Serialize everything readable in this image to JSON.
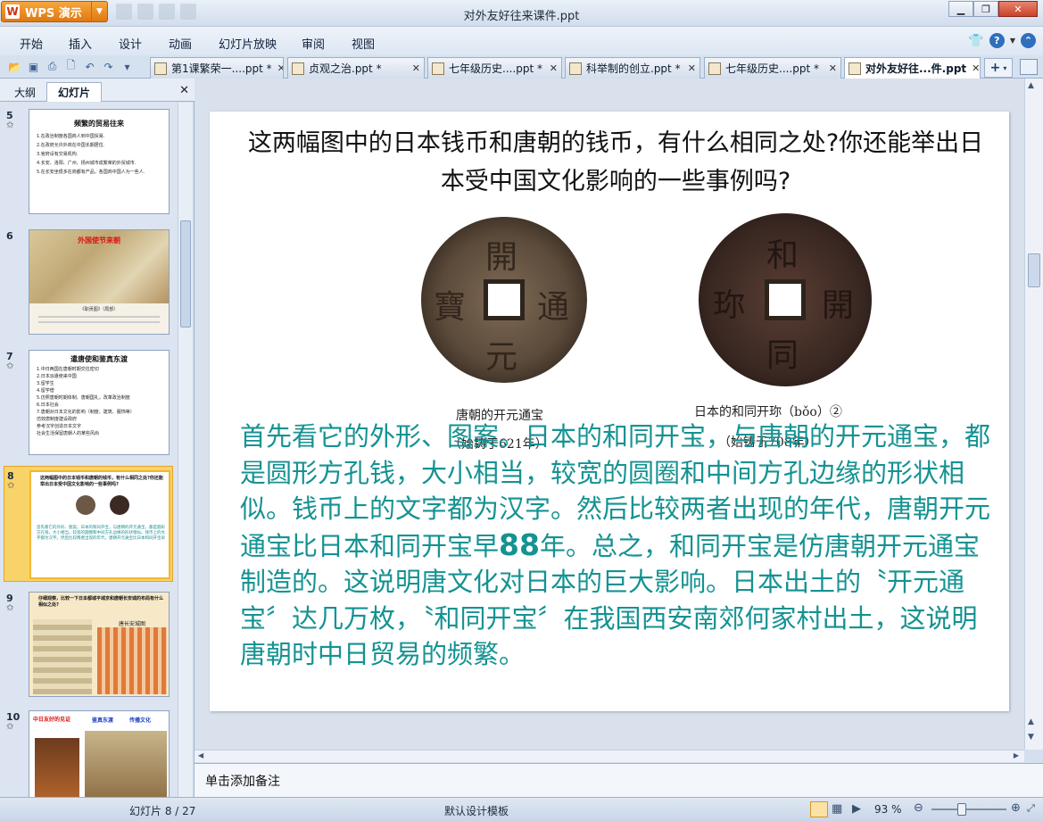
{
  "app": {
    "brand": "WPS 演示",
    "logo_letter": "W",
    "title": "对外友好往来课件.ppt"
  },
  "menu": [
    "开始",
    "插入",
    "设计",
    "动画",
    "幻灯片放映",
    "审阅",
    "视图"
  ],
  "tabs": [
    {
      "label": "第1课繁荣一....ppt *",
      "active": false
    },
    {
      "label": "贞观之治.ppt *",
      "active": false
    },
    {
      "label": "七年级历史....ppt *",
      "active": false
    },
    {
      "label": "科举制的创立.ppt *",
      "active": false
    },
    {
      "label": "七年级历史....ppt *",
      "active": false
    },
    {
      "label": "对外友好往...件.ppt",
      "active": true
    }
  ],
  "panel": {
    "tab_outline": "大纲",
    "tab_slides": "幻灯片"
  },
  "thumbnails": [
    {
      "num": "5",
      "title": "频繁的贸易往来",
      "lines": [
        "1.在政治制度各国商人到中国贸易.",
        "2.在政府允许外商在中国长期居住.",
        "3.官府设有交易机构.",
        "4.长安、洛阳、广州、扬州城市成繁荣的外贸城市.",
        "5.在长安坐很多在商都有产品，各国商中国人为一些人."
      ]
    },
    {
      "num": "6",
      "title": "外国使节来朝",
      "caption": "《职贡图》（局部）"
    },
    {
      "num": "7",
      "title": "遣唐使和鉴真东渡",
      "lines": [
        "1.中日两国在唐朝时期交往密切",
        "2.日本派遣使来中国",
        "3.留学生",
        "4.留学僧",
        "5.仿照唐朝时期体制、唐朝国礼，改革政治制度",
        "6.日本社会",
        "7.唐朝对日本文化的影响（制度、建筑、服饰等）",
        "仿效唐制度建设政府",
        "参考汉字创造日本文字",
        "社会生活保留唐朝人的某些风尚"
      ]
    },
    {
      "num": "8",
      "title": "这两幅图中的日本钱币和唐朝的钱币，有什么相同之处?你还能举出日本受中国文化影响的一些事例吗?"
    },
    {
      "num": "9",
      "title": "仔细观察，比较一下日本都城平城京和唐朝长安城的布局有什么相似之处?",
      "map_title": "唐长安城图"
    },
    {
      "num": "10",
      "title": "中日友好的见证",
      "sub1": "鉴真东渡",
      "sub2": "传播文化"
    }
  ],
  "slide": {
    "title": "这两幅图中的日本钱币和唐朝的钱币，有什么相同之处?你还能举出日本受中国文化影响的一些事例吗?",
    "coin1_caption": "唐朝的开元通宝",
    "coin1_sub": "（始铸于621年）",
    "coin2_caption": "日本的和同开珎（bǒo）②",
    "coin2_sub": "（始铸于708年）",
    "body_pre": "首先看它的外形、图案。日本的和同开宝，与唐朝的开元通宝，都是圆形方孔钱，大小相当，较宽的圆圈和中间方孔边缘的形状相似。钱币上的文字都为汉字。然后比较两者出现的年代，唐朝开元通宝比日本和同开宝早",
    "body_num": "88",
    "body_post": "年。总之，和同开宝是仿唐朝开元通宝制造的。这说明唐文化对日本的巨大影响。日本出土的〝开元通宝〞达几万枚，〝和同开宝〞在我国西安南郊何家村出土，这说明唐朝时中日贸易的频繁。"
  },
  "notes": "单击添加备注",
  "status": {
    "slide_count": "幻灯片 8 / 27",
    "template": "默认设计模板",
    "zoom": "93 %"
  },
  "colors": {
    "accent": "#f09020",
    "teal": "#159292",
    "selected": "#f8d36a"
  }
}
